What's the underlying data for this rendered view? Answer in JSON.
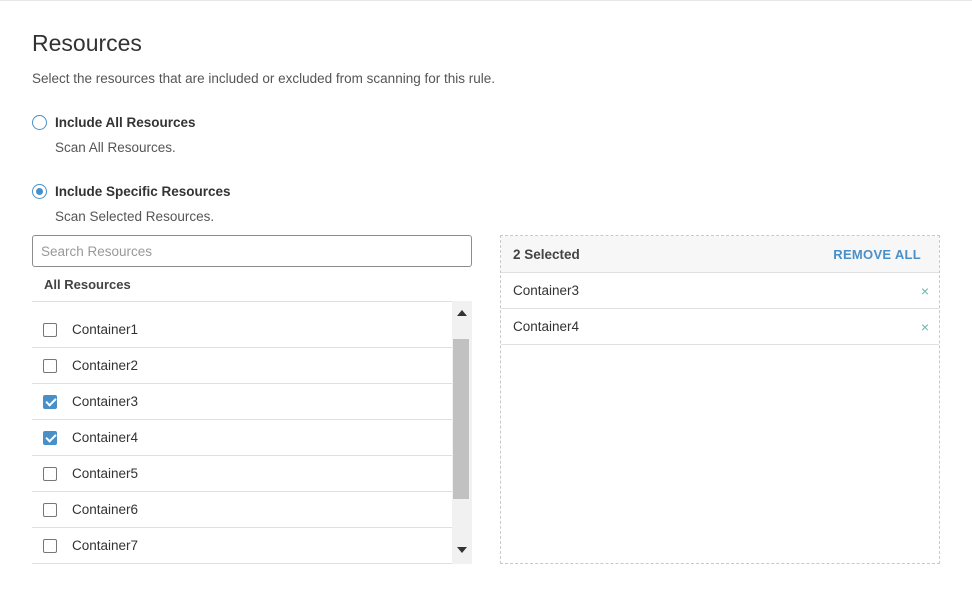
{
  "page": {
    "title": "Resources",
    "description": "Select the resources that are included or excluded from scanning for this rule."
  },
  "options": [
    {
      "label": "Include All Resources",
      "sublabel": "Scan All Resources.",
      "checked": false
    },
    {
      "label": "Include Specific Resources",
      "sublabel": "Scan Selected Resources.",
      "checked": true
    }
  ],
  "search": {
    "placeholder": "Search Resources",
    "value": ""
  },
  "all_resources": {
    "header": "All Resources",
    "items": [
      {
        "label": "Container1",
        "checked": false
      },
      {
        "label": "Container2",
        "checked": false
      },
      {
        "label": "Container3",
        "checked": true
      },
      {
        "label": "Container4",
        "checked": true
      },
      {
        "label": "Container5",
        "checked": false
      },
      {
        "label": "Container6",
        "checked": false
      },
      {
        "label": "Container7",
        "checked": false
      }
    ]
  },
  "selected": {
    "count_label": "2 Selected",
    "remove_all_label": "REMOVE ALL",
    "remove_icon": "×",
    "items": [
      {
        "label": "Container3"
      },
      {
        "label": "Container4"
      }
    ]
  },
  "colors": {
    "accent": "#4a90c8",
    "remove": "#6bb5a8"
  }
}
